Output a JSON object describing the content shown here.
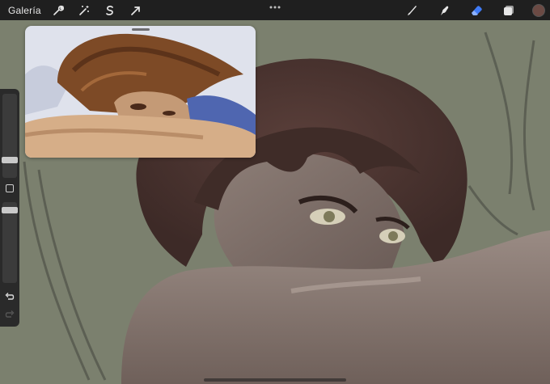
{
  "toolbar": {
    "gallery_label": "Galería",
    "left_tools": [
      {
        "name": "wrench-icon"
      },
      {
        "name": "magic-wand-icon"
      },
      {
        "name": "selection-s-icon"
      },
      {
        "name": "transform-arrow-icon"
      }
    ],
    "more_icon": "ellipsis-icon",
    "right_tools": [
      {
        "name": "brush-icon"
      },
      {
        "name": "smudge-icon"
      },
      {
        "name": "eraser-icon",
        "active": true
      },
      {
        "name": "layers-icon"
      }
    ],
    "current_color": "#6b4a44",
    "accent_color": "#3f7bf6"
  },
  "sidebar": {
    "brush_size_level": 0.3,
    "opacity_level": 0.5
  },
  "colors": {
    "canvas_background": "#7b806e",
    "hair": "#4b3430",
    "skin": "#8a7a72",
    "toolbar": "#1f1f1f"
  }
}
